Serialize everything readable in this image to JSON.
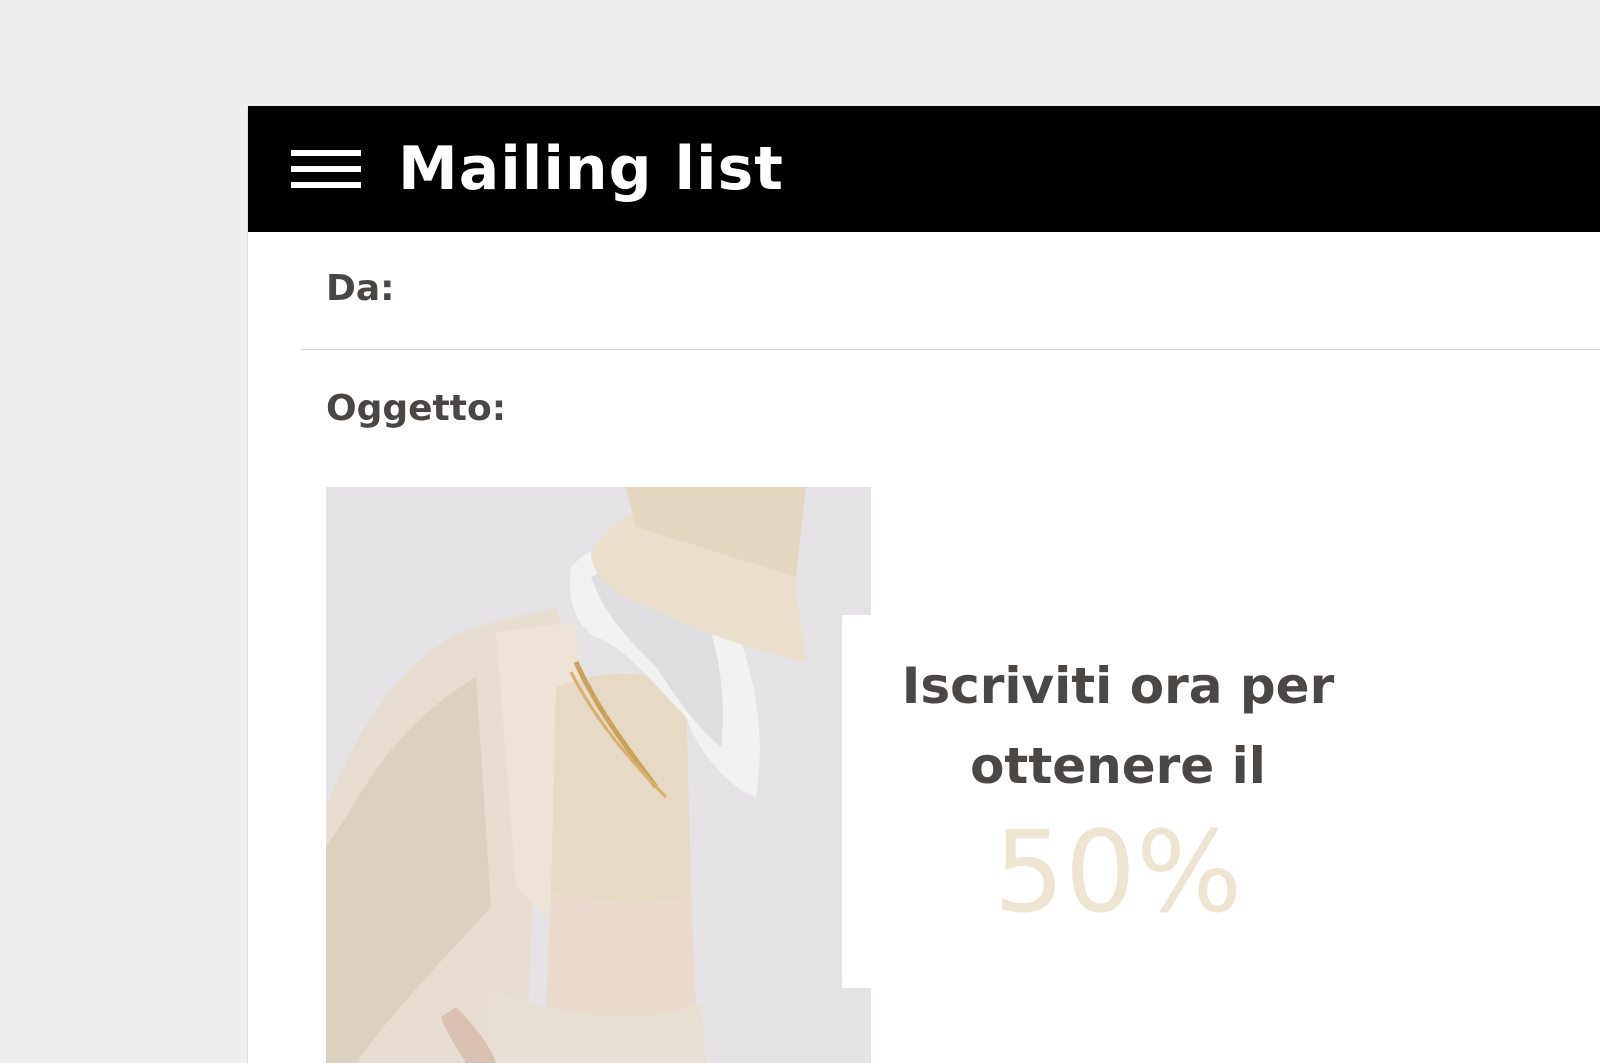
{
  "window": {
    "title": "Mailing list"
  },
  "toolbar": {
    "menu_icon": "hamburger-menu-icon"
  },
  "fields": {
    "from_label": "Da:",
    "from_value": "",
    "subject_label": "Oggetto:",
    "subject_value": ""
  },
  "email_body": {
    "image_alt": "Woman in beige bucket hat, cropped top and blazer",
    "promo_line1": "Iscriviti ora per",
    "promo_line2": "ottenere il",
    "promo_percent": "50%"
  },
  "colors": {
    "titlebar": "#000000",
    "label_text": "#4a4644",
    "promo_text": "#4b4745",
    "promo_accent": "#eee4d2",
    "background": "#efefef"
  }
}
